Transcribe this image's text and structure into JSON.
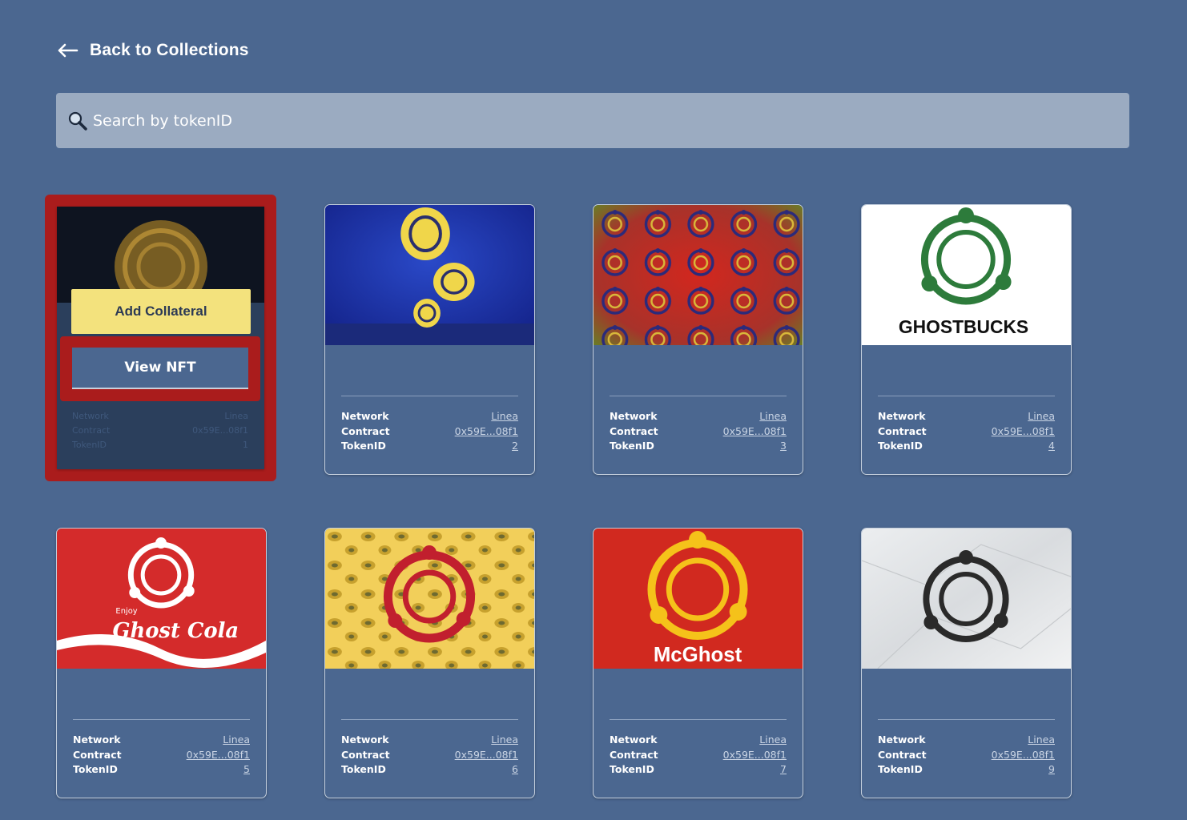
{
  "nav": {
    "back_label": "Back to Collections"
  },
  "search": {
    "placeholder": "Search by tokenID",
    "value": ""
  },
  "labels": {
    "network": "Network",
    "contract": "Contract",
    "token": "TokenID"
  },
  "selected_card": {
    "add_collateral_label": "Add Collateral",
    "view_nft_label": "View NFT",
    "network": "Linea",
    "contract": "0x59E...08f1",
    "token_id": "1"
  },
  "cards": [
    {
      "network": "Linea",
      "contract": "0x59E...08f1",
      "token_id": "2"
    },
    {
      "network": "Linea",
      "contract": "0x59E...08f1",
      "token_id": "3"
    },
    {
      "network": "Linea",
      "contract": "0x59E...08f1",
      "token_id": "4",
      "art_text": "GHOSTBUCKS"
    },
    {
      "network": "Linea",
      "contract": "0x59E...08f1",
      "token_id": "5",
      "art_text": "Ghost Cola",
      "art_small": "Enjoy"
    },
    {
      "network": "Linea",
      "contract": "0x59E...08f1",
      "token_id": "6"
    },
    {
      "network": "Linea",
      "contract": "0x59E...08f1",
      "token_id": "7",
      "art_text": "McGhost"
    },
    {
      "network": "Linea",
      "contract": "0x59E...08f1",
      "token_id": "9"
    }
  ],
  "colors": {
    "background": "#4b6790",
    "search_bg": "#9babc1",
    "highlight": "#aa1c1c",
    "collateral_button": "#f3e27d"
  },
  "icons": {
    "back": "arrow-left-icon",
    "search": "magnifier-icon"
  }
}
